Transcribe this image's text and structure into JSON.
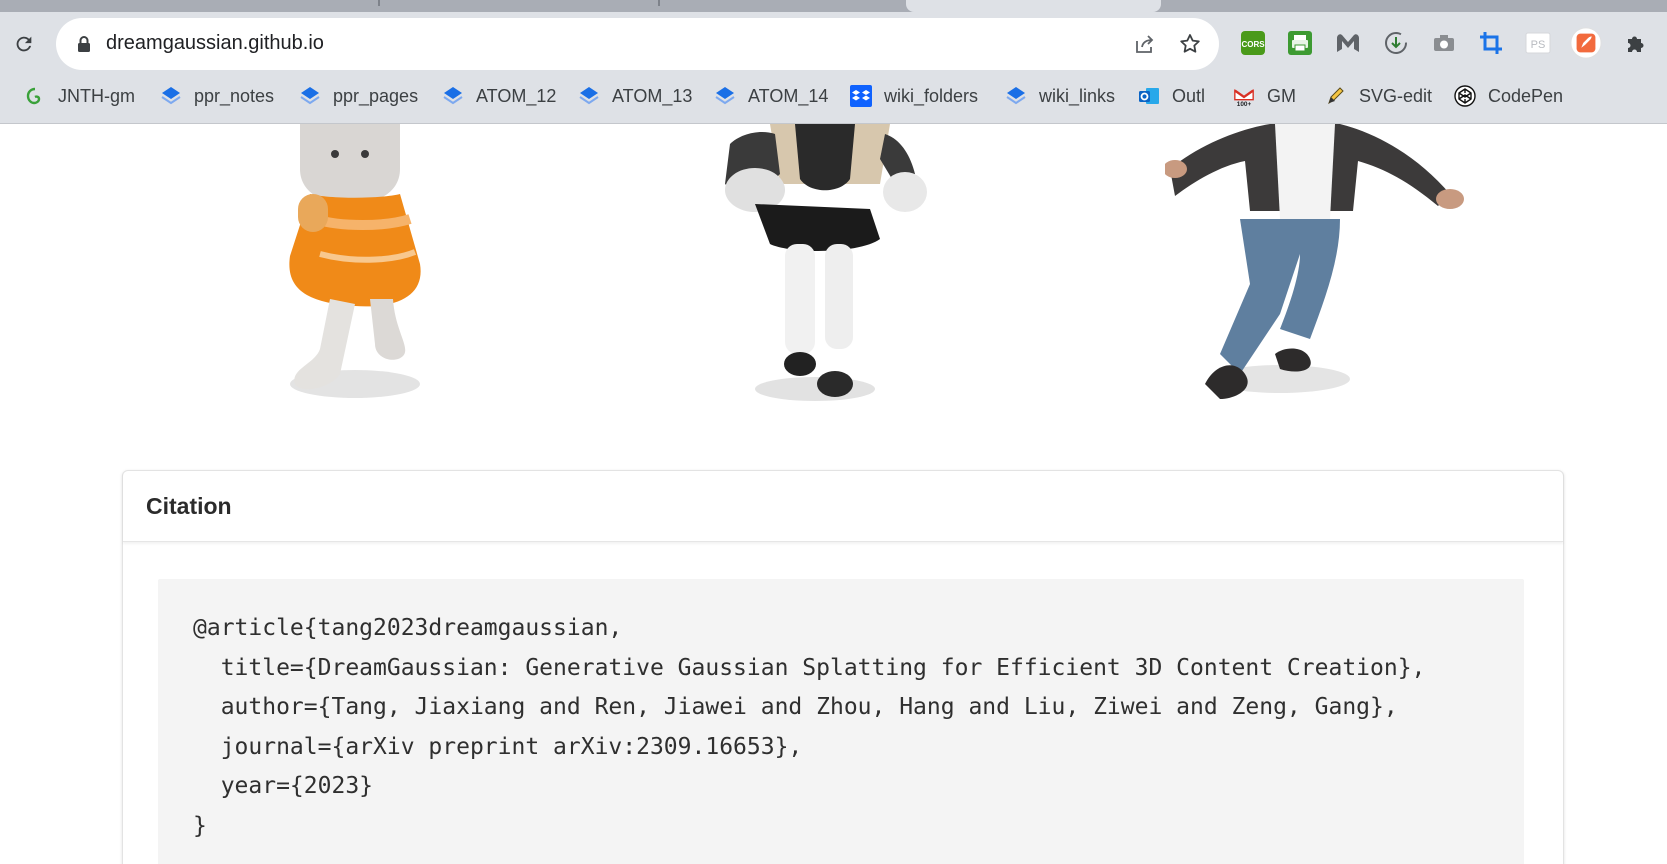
{
  "browser": {
    "url": "dreamgaussian.github.io",
    "bookmarks": [
      {
        "label": "JNTH-gm",
        "icon": "greasemonkey-icon"
      },
      {
        "label": "ppr_notes",
        "icon": "atom-layers-icon"
      },
      {
        "label": "ppr_pages",
        "icon": "atom-layers-icon"
      },
      {
        "label": "ATOM_12",
        "icon": "atom-layers-icon"
      },
      {
        "label": "ATOM_13",
        "icon": "atom-layers-icon"
      },
      {
        "label": "ATOM_14",
        "icon": "atom-layers-icon"
      },
      {
        "label": "wiki_folders",
        "icon": "dropbox-icon"
      },
      {
        "label": "wiki_links",
        "icon": "atom-layers-icon"
      },
      {
        "label": "Outl",
        "icon": "outlook-icon"
      },
      {
        "label": "GM",
        "icon": "gmail-icon"
      },
      {
        "label": "SVG-edit",
        "icon": "pencil-icon"
      },
      {
        "label": "CodePen",
        "icon": "codepen-icon"
      }
    ],
    "extensions": [
      {
        "name": "cors-extension-icon",
        "text": "CORS",
        "color": "#4a9a1a"
      },
      {
        "name": "print-extension-icon",
        "color": "#3d9a32"
      },
      {
        "name": "malwarebytes-extension-icon",
        "color": "#5f6368"
      },
      {
        "name": "download-extension-icon",
        "color": "#5f6368"
      },
      {
        "name": "screenshot-extension-icon",
        "color": "#8a8d91"
      },
      {
        "name": "crop-extension-icon",
        "color": "#1a73e8"
      },
      {
        "name": "photoshop-extension-icon",
        "text": "PS",
        "color": "#b8bbc0"
      },
      {
        "name": "rocket-extension-icon",
        "color": "#f26a3d"
      },
      {
        "name": "extensions-puzzle-icon",
        "color": "#3c4043"
      }
    ]
  },
  "citation": {
    "heading": "Citation",
    "bibtex": "@article{tang2023dreamgaussian,\n  title={DreamGaussian: Generative Gaussian Splatting for Efficient 3D Content Creation},\n  author={Tang, Jiaxiang and Ren, Jiawei and Zhou, Hang and Liu, Ziwei and Zeng, Gang},\n  journal={arXiv preprint arXiv:2309.16653},\n  year={2023}\n}"
  }
}
